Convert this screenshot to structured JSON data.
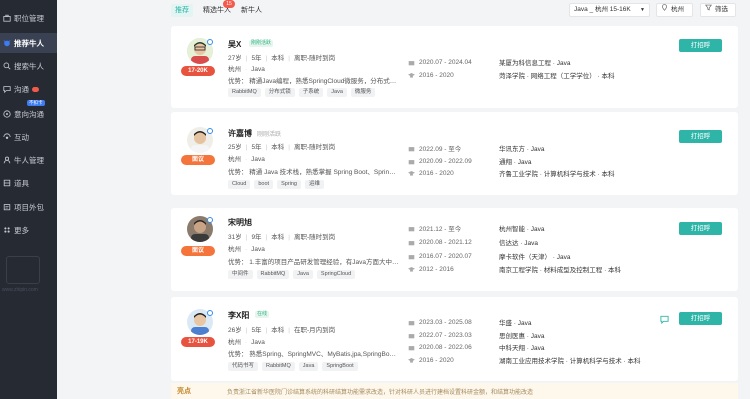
{
  "sidebar": {
    "items": [
      {
        "label": "职位管理",
        "icon": "briefcase-icon"
      },
      {
        "label": "推荐牛人",
        "icon": "cow-icon",
        "active": true
      },
      {
        "label": "搜索牛人",
        "icon": "search-icon"
      },
      {
        "label": "沟通",
        "icon": "chat-icon",
        "badge": true
      },
      {
        "label": "意向沟通",
        "icon": "chat-heart-icon",
        "tag": "不扣卡"
      },
      {
        "label": "互动",
        "icon": "interact-icon"
      },
      {
        "label": "牛人管理",
        "icon": "people-icon"
      },
      {
        "label": "道具",
        "icon": "tool-icon"
      },
      {
        "label": "项目外包",
        "icon": "project-icon"
      },
      {
        "label": "更多",
        "icon": "more-icon"
      }
    ],
    "watermark_url": "www.zhipin.com"
  },
  "topbar": {
    "tabs": [
      "推荐",
      "精选牛人",
      "新牛人"
    ],
    "featured_count": "15",
    "job_filter": "Java _ 杭州 15-16K",
    "city": "杭州",
    "filter": "筛选"
  },
  "greet_label": "打招呼",
  "candidates": [
    {
      "name": "吴X",
      "status": "刚刚活跃",
      "salary": "17-20K",
      "salary_style": "red",
      "info": [
        "27岁",
        "5年",
        "本科",
        "离职-随时到岗"
      ],
      "expect": [
        "杭州",
        "Java"
      ],
      "advantage": "优势：  精通Java编程，熟悉SpringCloud微服务，分布式…",
      "tags": [
        "RabbitMQ",
        "分布式锁",
        "子系统",
        "Java",
        "微服务"
      ],
      "experience": [
        {
          "type": "work",
          "date": "2020.07 - 2024.04",
          "org": "某厦为科信息工程 · Java"
        },
        {
          "type": "edu",
          "date": "2016 - 2020",
          "org": "菏泽学院 · 网络工程（工学学位） · 本科"
        }
      ]
    },
    {
      "name": "许嘉博",
      "status": "刚刚活跃",
      "salary": "面议",
      "salary_style": "orange",
      "info": [
        "25岁",
        "5年",
        "本科",
        "离职-随时到岗"
      ],
      "expect": [
        "杭州",
        "Java"
      ],
      "advantage": "优势：  精通 Java 技术栈，熟悉掌握 Spring Boot、Sprin…",
      "tags": [
        "Cloud",
        "boot",
        "Spring",
        "运维"
      ],
      "experience": [
        {
          "type": "work",
          "date": "2022.09 - 至今",
          "org": "华讯东方 · Java"
        },
        {
          "type": "work",
          "date": "2020.09 - 2022.09",
          "org": "通翔 · Java"
        },
        {
          "type": "edu",
          "date": "2016 - 2020",
          "org": "齐鲁工业学院 · 计算机科学与技术 · 本科"
        }
      ]
    },
    {
      "name": "宋明旭",
      "status": "",
      "salary": "面议",
      "salary_style": "orange",
      "info": [
        "31岁",
        "9年",
        "本科",
        "离职-随时到岗"
      ],
      "expect": [
        "杭州",
        "Java"
      ],
      "advantage": "优势：  1.丰富的项目产品研发管理经验，有Java方面大中…",
      "tags": [
        "中间件",
        "RabbitMQ",
        "Java",
        "SpringCloud"
      ],
      "experience": [
        {
          "type": "work",
          "date": "2021.12 - 至今",
          "org": "杭州智能 · Java"
        },
        {
          "type": "work",
          "date": "2020.08 - 2021.12",
          "org": "信达达 · Java"
        },
        {
          "type": "work",
          "date": "2016.07 - 2020.07",
          "org": "摩卡软件（天津） · Java"
        },
        {
          "type": "edu",
          "date": "2012 - 2016",
          "org": "南京工程学院 · 材料成型及控制工程 · 本科"
        }
      ]
    },
    {
      "name": "李X阳",
      "status": "在线",
      "salary": "17-19K",
      "salary_style": "red",
      "info": [
        "26岁",
        "5年",
        "本科",
        "在职-月内到岗"
      ],
      "expect": [
        "杭州",
        "Java"
      ],
      "advantage": "优势：  熟悉Spring、SpringMVC、MyBatis,jpa,SpringBo…",
      "tags": [
        "代码书写",
        "RabbitMQ",
        "Java",
        "SpringBoot"
      ],
      "experience": [
        {
          "type": "work",
          "date": "2023.03 - 2025.08",
          "org": "华盛 · Java"
        },
        {
          "type": "work",
          "date": "2022.07 - 2023.03",
          "org": "思创医惠 · Java"
        },
        {
          "type": "work",
          "date": "2020.08 - 2022.06",
          "org": "中科天翔 · Java"
        },
        {
          "type": "edu",
          "date": "2016 - 2020",
          "org": "湖南工业应用技术学院 · 计算机科学与技术 · 本科"
        }
      ]
    }
  ],
  "highlight": {
    "label": "亮点",
    "text": "负责浙江省新华医院门诊结算系统的科研结算功能需求改造，针对科研人员进行建档设置科研金额，和结算功能改造"
  }
}
